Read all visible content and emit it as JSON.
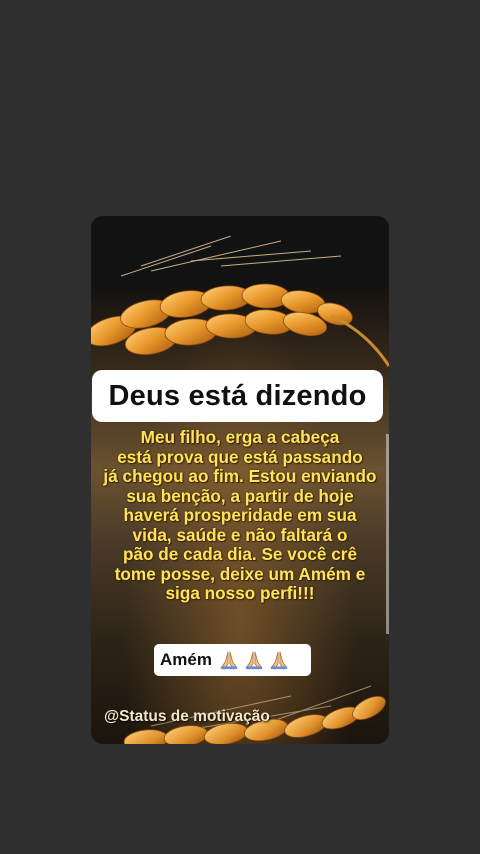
{
  "post": {
    "title": "Deus está dizendo",
    "message": "Meu filho, erga a cabeça\nestá prova que está passando\njá chegou ao fim. Estou enviando\nsua benção, a partir de hoje\nhaverá prosperidade em sua\nvida, saúde e não faltará o\npão de cada dia. Se você crê\ntome posse, deixe um Amém e\nsiga nosso perfi!!!",
    "amen_label": "Amém",
    "amen_icons": [
      "praying-hands-icon",
      "praying-hands-icon",
      "praying-hands-icon"
    ],
    "handle": "@Status de motivação"
  },
  "colors": {
    "background": "#2f2f2f",
    "message_text": "#ffe35a",
    "box_white": "#ffffff"
  }
}
